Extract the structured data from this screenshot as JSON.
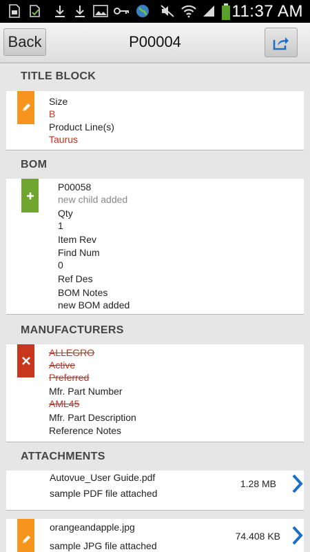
{
  "status_bar": {
    "time": "11:37 AM"
  },
  "header": {
    "back_label": "Back",
    "title": "P00004"
  },
  "sections": {
    "title_block": {
      "heading": "TITLE BLOCK",
      "fields": [
        {
          "label": "Size",
          "value": "B"
        },
        {
          "label": "Product Line(s)",
          "value": "Taurus"
        }
      ]
    },
    "bom": {
      "heading": "BOM",
      "item_number": "P00058",
      "change_note": "new child added",
      "fields": [
        {
          "label": "Qty",
          "value": "1"
        },
        {
          "label": "Item Rev",
          "value": ""
        },
        {
          "label": "Find Num",
          "value": "0"
        },
        {
          "label": "Ref Des",
          "value": ""
        },
        {
          "label": "BOM Notes",
          "value": "new BOM added"
        }
      ]
    },
    "manufacturers": {
      "heading": "MANUFACTURERS",
      "name": "ALLEGRO",
      "status": "Active",
      "preference": "Preferred",
      "part_number_label": "Mfr. Part Number",
      "part_number": "AML45",
      "description_label": "Mfr. Part Description",
      "notes_label": "Reference Notes"
    },
    "attachments": {
      "heading": "ATTACHMENTS",
      "items": [
        {
          "filename": "Autovue_User Guide.pdf",
          "description": "sample PDF file attached",
          "size": "1.28 MB"
        },
        {
          "filename": "orangeandapple.jpg",
          "description": "sample JPG file attached",
          "size": "74.408 KB"
        }
      ]
    }
  },
  "colors": {
    "edited_marker": "#f7941d",
    "added_marker": "#70a62f",
    "deleted_marker": "#c8361d",
    "changed_value_text": "#c7301e",
    "chevron": "#1a6fc9"
  }
}
